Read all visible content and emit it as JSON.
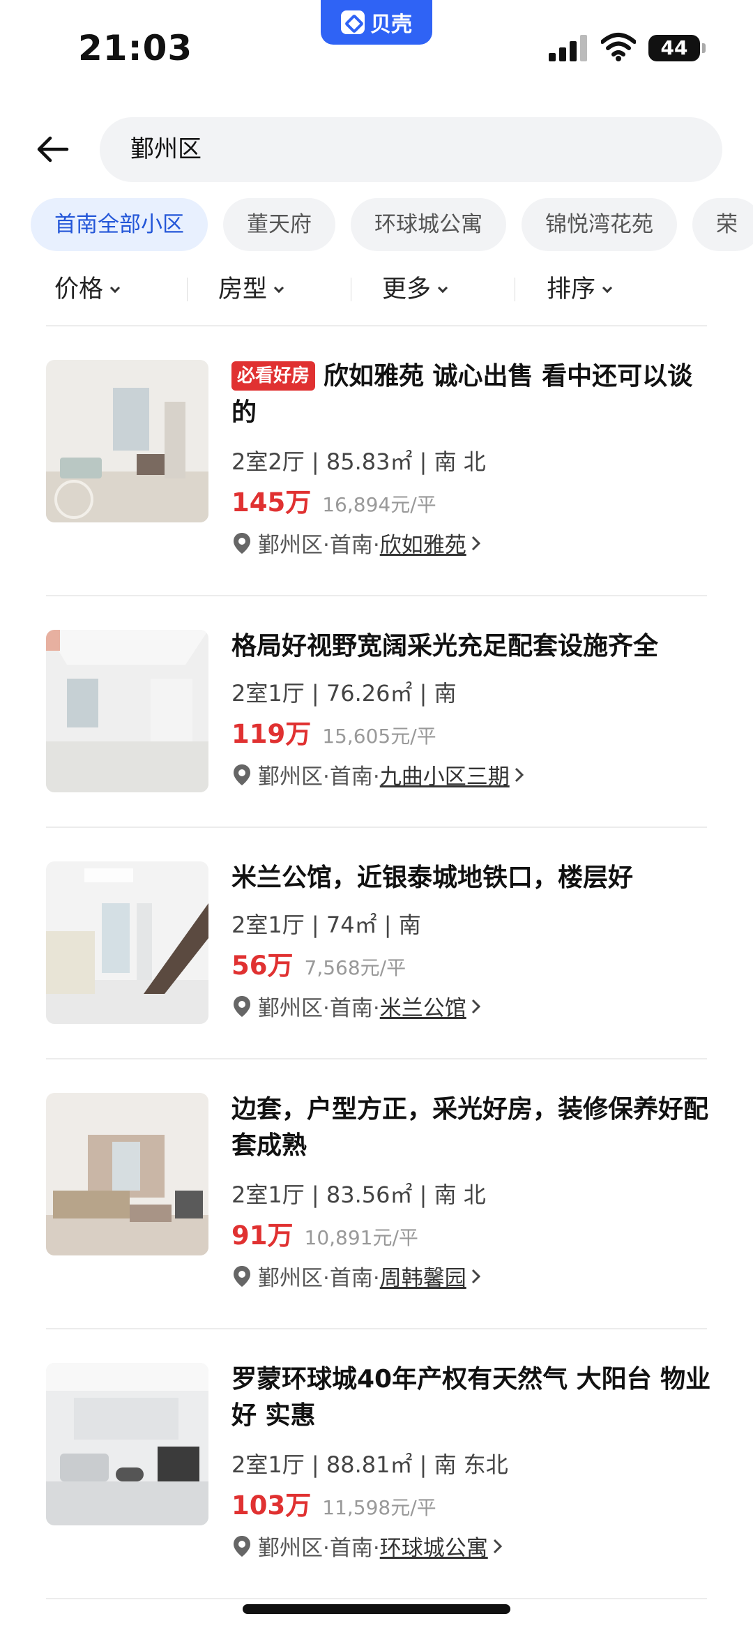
{
  "status_bar": {
    "time": "21:03",
    "battery": "44",
    "app_pill_label": "贝壳"
  },
  "search": {
    "query": "鄞州区"
  },
  "chips": [
    "首南全部小区",
    "董天府",
    "环球城公寓",
    "锦悦湾花苑",
    "荣"
  ],
  "filters": [
    "价格",
    "房型",
    "更多",
    "排序"
  ],
  "listings": [
    {
      "badge": "必看好房",
      "title": "欣如雅苑 诚心出售 看中还可以谈的",
      "specs": "2室2厅 | 85.83㎡ | 南 北",
      "price": "145万",
      "unit_price": "16,894元/平",
      "district": "鄞州区·首南·",
      "community": "欣如雅苑"
    },
    {
      "badge": "",
      "title": "格局好视野宽阔采光充足配套设施齐全",
      "specs": "2室1厅 | 76.26㎡ | 南",
      "price": "119万",
      "unit_price": "15,605元/平",
      "district": "鄞州区·首南·",
      "community": "九曲小区三期"
    },
    {
      "badge": "",
      "title": "米兰公馆，近银泰城地铁口，楼层好",
      "specs": "2室1厅 | 74㎡ | 南",
      "price": "56万",
      "unit_price": "7,568元/平",
      "district": "鄞州区·首南·",
      "community": "米兰公馆"
    },
    {
      "badge": "",
      "title": "边套，户型方正，采光好房，装修保养好配套成熟",
      "specs": "2室1厅 | 83.56㎡ | 南 北",
      "price": "91万",
      "unit_price": "10,891元/平",
      "district": "鄞州区·首南·",
      "community": "周韩馨园"
    },
    {
      "badge": "",
      "title": "罗蒙环球城40年产权有天然气 大阳台 物业好 实惠",
      "specs": "2室1厅 | 88.81㎡ | 南 东北",
      "price": "103万",
      "unit_price": "11,598元/平",
      "district": "鄞州区·首南·",
      "community": "环球城公寓"
    }
  ]
}
